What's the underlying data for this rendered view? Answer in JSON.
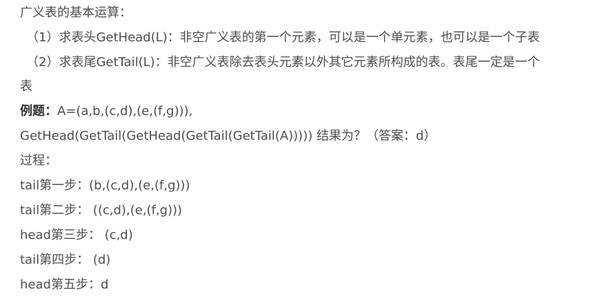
{
  "content": {
    "heading": "广义表的基本运算：",
    "op1": "（1）求表头GetHead(L)：非空广义表的第一个元素，可以是一个单元素，也可以是一个子表",
    "op2_line1": "（2）求表尾GetTail(L)：非空广义表除去表头元素以外其它元素所构成的表。表尾一定是一个",
    "op2_line2": "表",
    "example_label": "例题：",
    "example_text": "A=(a,b,(c,d),(e,(f,g))),",
    "question": "GetHead(GetTail(GetHead(GetTail(GetTail(A))))) 结果为？（答案：d）",
    "process_label": "过程：",
    "step1": "tail第一步：(b,(c,d),(e,(f,g)))",
    "step2": "tail第二步：  ((c,d),(e,(f,g)))",
    "step3": "head第三步：  (c,d)",
    "step4": "tail第四步：  (d)",
    "step5": "head第五步：d"
  }
}
